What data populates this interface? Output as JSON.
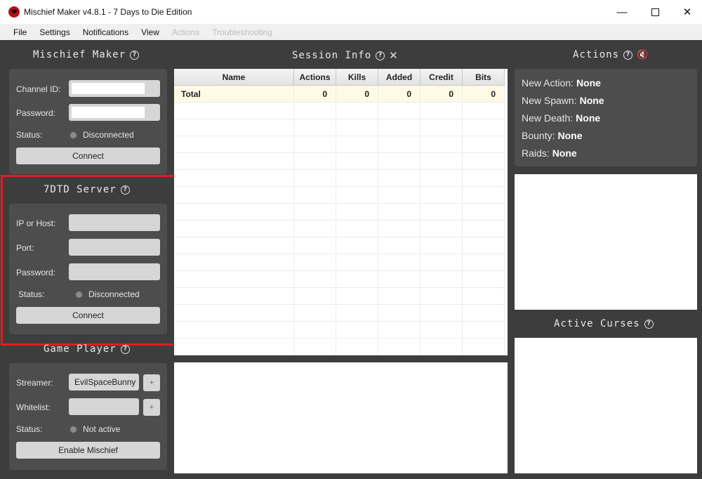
{
  "window": {
    "title": "Mischief Maker v4.8.1 - 7 Days to Die Edition",
    "minimize": "—",
    "close": "✕"
  },
  "menu": [
    "File",
    "Settings",
    "Notifications",
    "View",
    "Actions",
    "Troubleshooting"
  ],
  "mischief": {
    "title": "Mischief Maker",
    "channel_label": "Channel ID:",
    "password_label": "Password:",
    "status_label": "Status:",
    "status_value": "Disconnected",
    "connect_label": "Connect"
  },
  "server": {
    "title": "7DTD Server",
    "ip_label": "IP or Host:",
    "port_label": "Port:",
    "password_label": "Password:",
    "status_label": "Status:",
    "status_value": "Disconnected",
    "connect_label": "Connect"
  },
  "player": {
    "title": "Game Player",
    "streamer_label": "Streamer:",
    "streamer_value": "EvilSpaceBunny",
    "whitelist_label": "Whitelist:",
    "add_label": "+",
    "status_label": "Status:",
    "status_value": "Not active",
    "enable_label": "Enable Mischief"
  },
  "session": {
    "title": "Session Info",
    "columns": [
      "Name",
      "Actions",
      "Kills",
      "Added",
      "Credit",
      "Bits"
    ],
    "total_row": [
      "Total",
      "0",
      "0",
      "0",
      "0",
      "0"
    ]
  },
  "actions": {
    "title": "Actions",
    "new_action_label": "New Action:",
    "new_action_value": "None",
    "new_spawn_label": "New Spawn:",
    "new_spawn_value": "None",
    "new_death_label": "New Death:",
    "new_death_value": "None",
    "bounty_label": "Bounty:",
    "bounty_value": "None",
    "raids_label": "Raids:",
    "raids_value": "None"
  },
  "curses": {
    "title": "Active Curses"
  },
  "icons": {
    "help": "?",
    "close": "✕",
    "speaker": "🔇"
  },
  "colors": {
    "highlight": "#e11d22",
    "background": "#3d3d3d",
    "panel": "#4d4d4d"
  }
}
